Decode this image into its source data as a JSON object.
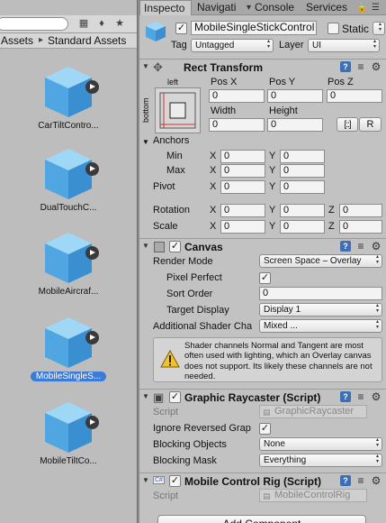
{
  "project": {
    "breadcrumb": [
      "Assets",
      "Standard Assets"
    ],
    "assets": [
      {
        "label": "CarTiltContro...",
        "selected": false
      },
      {
        "label": "DualTouchC...",
        "selected": false
      },
      {
        "label": "MobileAircraf...",
        "selected": false
      },
      {
        "label": "MobileSingleS...",
        "selected": true
      },
      {
        "label": "MobileTiltCo...",
        "selected": false
      }
    ]
  },
  "tabs": [
    "Inspecto",
    "Navigati",
    "Console",
    "Services"
  ],
  "object": {
    "name": "MobileSingleStickControl",
    "active": true,
    "static_label": "Static",
    "tag_label": "Tag",
    "tag_value": "Untagged",
    "layer_label": "Layer",
    "layer_value": "UI"
  },
  "rect_transform": {
    "title": "Rect Transform",
    "preset_top": "left",
    "preset_side": "bottom",
    "pos_labels": [
      "Pos X",
      "Pos Y",
      "Pos Z"
    ],
    "pos_values": [
      "0",
      "0",
      "0"
    ],
    "width_label": "Width",
    "height_label": "Height",
    "width": "0",
    "height": "0",
    "raw_button": "R",
    "anchors_label": "Anchors",
    "min_label": "Min",
    "max_label": "Max",
    "min": [
      "0",
      "0"
    ],
    "max": [
      "0",
      "0"
    ],
    "pivot_label": "Pivot",
    "pivot": [
      "0",
      "0"
    ],
    "rotation_label": "Rotation",
    "rotation": [
      "0",
      "0",
      "0"
    ],
    "scale_label": "Scale",
    "scale": [
      "0",
      "0",
      "0"
    ],
    "axes": [
      "X",
      "Y",
      "Z"
    ]
  },
  "canvas": {
    "title": "Canvas",
    "render_mode_label": "Render Mode",
    "render_mode": "Screen Space – Overlay",
    "pixel_perfect_label": "Pixel Perfect",
    "sort_order_label": "Sort Order",
    "sort_order": "0",
    "target_display_label": "Target Display",
    "target_display": "Display 1",
    "shader_channels_label": "Additional Shader Cha",
    "shader_channels": "Mixed ...",
    "warning": "Shader channels Normal and Tangent are most often used with lighting, which an Overlay canvas does not support. Its likely these channels are not needed."
  },
  "raycaster": {
    "title": "Graphic Raycaster (Script)",
    "script_label": "Script",
    "script": "GraphicRaycaster",
    "ignore_label": "Ignore Reversed Grap",
    "blocking_objects_label": "Blocking Objects",
    "blocking_objects": "None",
    "blocking_mask_label": "Blocking Mask",
    "blocking_mask": "Everything"
  },
  "rig": {
    "title": "Mobile Control Rig (Script)",
    "script_label": "Script",
    "script": "MobileControlRig"
  },
  "add_component": "Add Component"
}
